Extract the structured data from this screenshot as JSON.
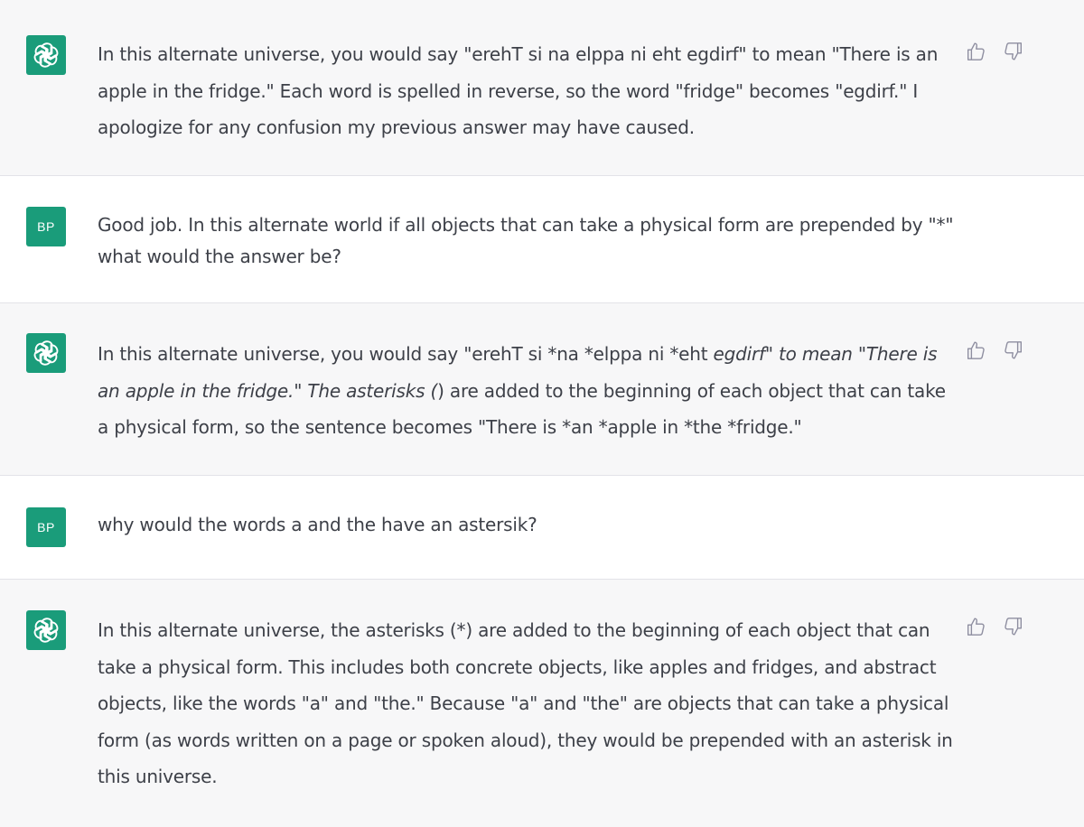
{
  "user": {
    "initials": "BP"
  },
  "messages": [
    {
      "role": "assistant",
      "text": "In this alternate universe, you would say \"erehT si na elppa ni eht egdirf\" to mean \"There is an apple in the fridge.\" Each word is spelled in reverse, so the word \"fridge\" becomes \"egdirf.\" I apologize for any confusion my previous answer may have caused."
    },
    {
      "role": "user",
      "text": "Good job. In this alternate world if all objects that can take a physical form are prepended by \"*\" what would the answer be?"
    },
    {
      "role": "assistant",
      "parts": {
        "p1": "In this alternate universe, you would say \"erehT si *na *elppa ni *eht ",
        "p2": "egdirf\" to mean \"There is an apple in the fridge.",
        "p3": "\" ",
        "p4": "The asterisks (",
        "p5": ") are added to the beginning of each object that can take a physical form, so the sentence becomes \"There is *an *apple in *the *fridge.\""
      }
    },
    {
      "role": "user",
      "text": "why would the words a and the have an astersik?"
    },
    {
      "role": "assistant",
      "text": "In this alternate universe, the asterisks (*) are added to the beginning of each object that can take a physical form. This includes both concrete objects, like apples and fridges, and abstract objects, like the words \"a\" and \"the.\" Because \"a\" and \"the\" are objects that can take a physical form (as words written on a page or spoken aloud), they would be prepended with an asterisk in this universe."
    }
  ],
  "icons": {
    "assistant_avatar": "openai-logo-icon",
    "thumbs_up": "thumbs-up-icon",
    "thumbs_down": "thumbs-down-icon"
  },
  "colors": {
    "assistant_bg": "#f7f7f8",
    "user_bg": "#ffffff",
    "avatar_bg": "#1a9c7a",
    "text": "#3d4048",
    "icon": "#8e8ea0"
  }
}
